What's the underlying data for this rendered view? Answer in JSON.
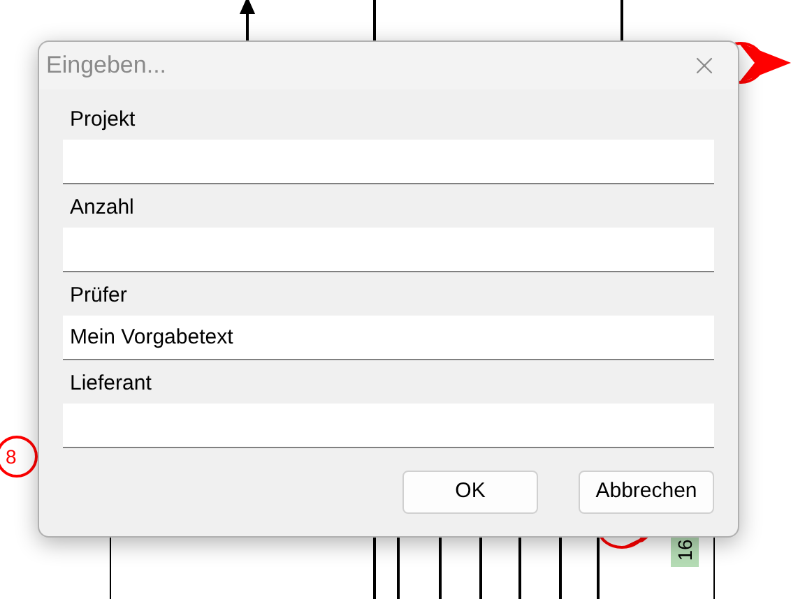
{
  "canvas": {
    "marker_label": "8",
    "tag_label": "16"
  },
  "dialog": {
    "title": "Eingeben...",
    "fields": [
      {
        "label": "Projekt"
      },
      {
        "label": "Anzahl"
      },
      {
        "label": "Prüfer",
        "value": "Mein Vorgabetext"
      },
      {
        "label": "Lieferant"
      }
    ],
    "buttons": [
      "OK",
      "Abbrechen"
    ]
  }
}
